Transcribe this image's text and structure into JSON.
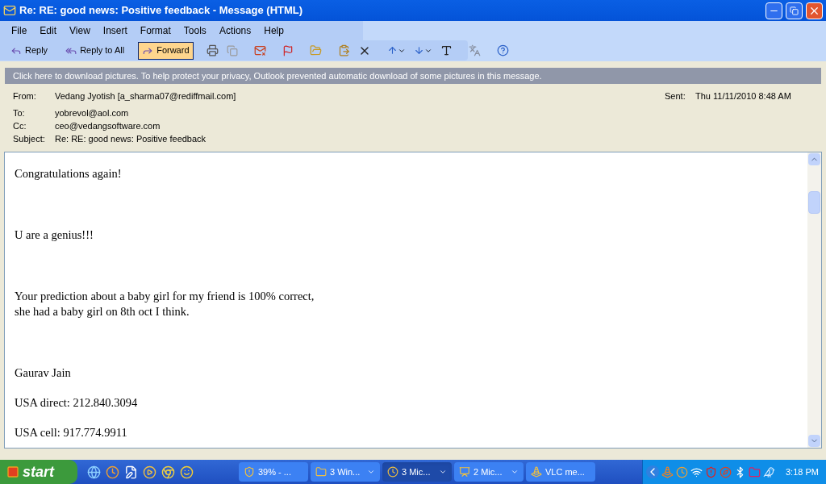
{
  "window": {
    "title": "Re: RE: good news: Positive feedback - Message (HTML)"
  },
  "menu": [
    "File",
    "Edit",
    "View",
    "Insert",
    "Format",
    "Tools",
    "Actions",
    "Help"
  ],
  "toolbar": [
    {
      "label": "Reply",
      "selected": false
    },
    {
      "label": "Reply to All",
      "selected": false
    },
    {
      "label": "Forward",
      "selected": true
    }
  ],
  "infobar": "Click here to download pictures. To help protect your privacy, Outlook prevented automatic download of some pictures in this message.",
  "header": {
    "from_label": "From:",
    "from": "Vedang Jyotish [a_sharma07@rediffmail.com]",
    "sent_label": "Sent:",
    "sent": "Thu 11/11/2010 8:48 AM",
    "fields": [
      {
        "label": "To:",
        "value": "yobrevol@aol.com"
      },
      {
        "label": "Cc:",
        "value": "ceo@vedangsoftware.com"
      },
      {
        "label": "Subject:",
        "value": "Re: RE: good news: Positive feedback"
      }
    ]
  },
  "body": [
    {
      "lines": [
        "Congratulations again!"
      ]
    },
    {
      "lines": [
        "U are a genius!!!"
      ]
    },
    {
      "lines": [
        "Your prediction about a baby girl for my friend is 100% correct,",
        "she had a baby girl on 8th oct I think."
      ]
    },
    {
      "lines": [
        "Gaurav Jain"
      ]
    },
    {
      "lines": [
        "USA direct: 212.840.3094"
      ]
    },
    {
      "lines": [
        "USA cell: 917.774.9911"
      ]
    }
  ],
  "taskbar": {
    "start": "start",
    "tasks": [
      {
        "label": "39% - ...",
        "selected": false,
        "menu": false
      },
      {
        "label": "3 Win...",
        "selected": false,
        "menu": true
      },
      {
        "label": "3 Mic...",
        "selected": true,
        "menu": true
      },
      {
        "label": "2 Mic...",
        "selected": false,
        "menu": true
      },
      {
        "label": "VLC me...",
        "selected": false,
        "menu": false
      }
    ],
    "time": "3:18 PM"
  }
}
